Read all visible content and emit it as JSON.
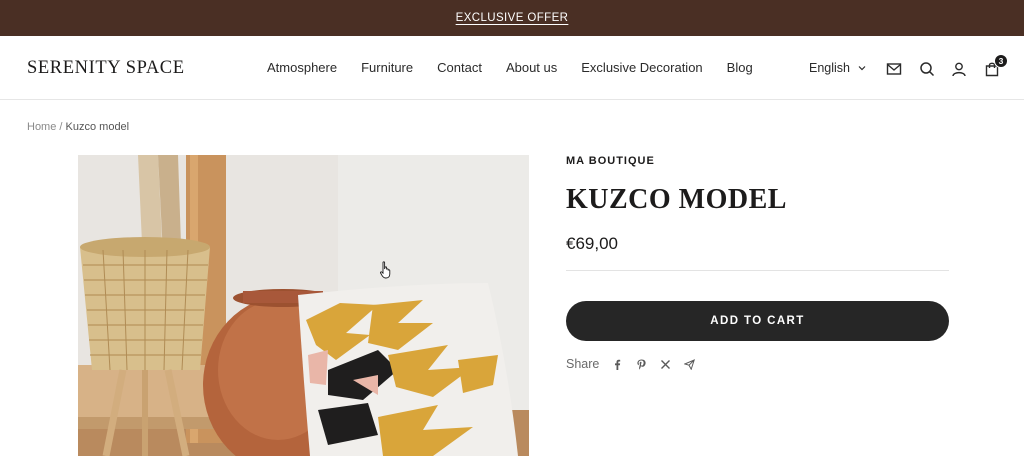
{
  "announcement": {
    "text": "EXCLUSIVE OFFER"
  },
  "header": {
    "logo": "SERENITY SPACE",
    "nav": [
      "Atmosphere",
      "Furniture",
      "Contact",
      "About us",
      "Exclusive Decoration",
      "Blog"
    ],
    "language": "English",
    "cart_count": "3",
    "icons": [
      "mail-icon",
      "search-icon",
      "account-icon",
      "cart-icon"
    ]
  },
  "breadcrumb": {
    "home": "Home",
    "separator": "/",
    "current": "Kuzco model"
  },
  "product": {
    "vendor": "MA BOUTIQUE",
    "title": "KUZCO MODEL",
    "price": "€69,00",
    "add_to_cart": "ADD TO CART",
    "share_label": "Share",
    "share_icons": [
      "facebook-icon",
      "pinterest-icon",
      "x-icon",
      "email-share-icon"
    ]
  },
  "colors": {
    "announcement_bg": "#4a2f24",
    "button_bg": "#262626",
    "text": "#1c1b1b"
  }
}
